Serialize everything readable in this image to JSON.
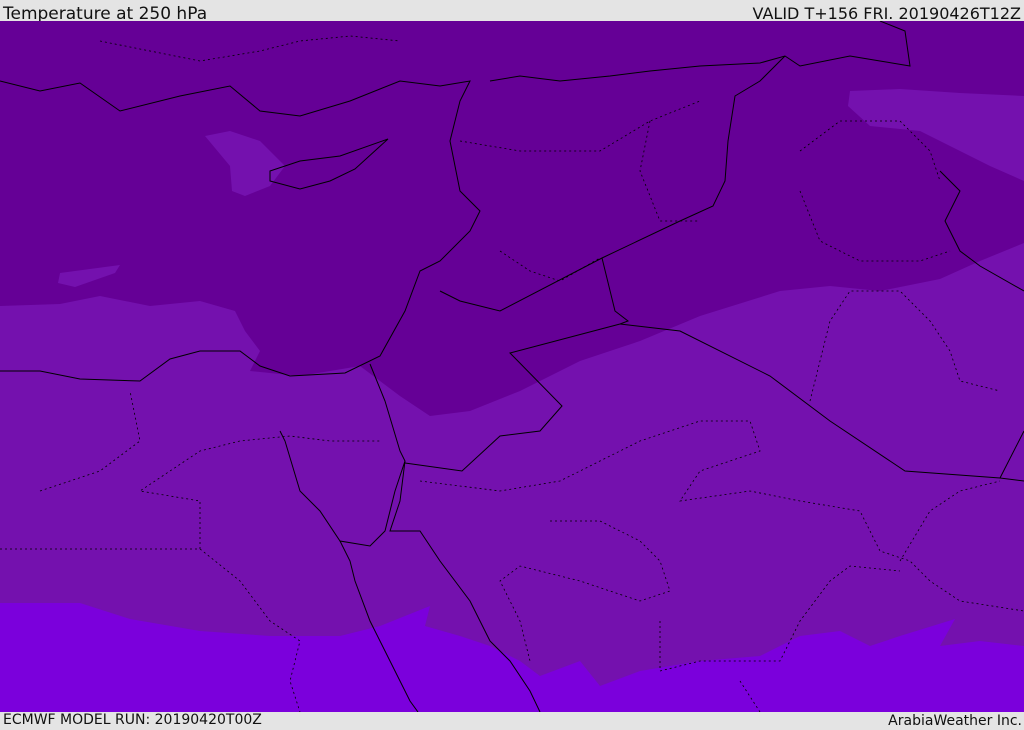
{
  "header": {
    "title": "Temperature at 250 hPa",
    "valid": "VALID T+156 FRI. 20190426T12Z"
  },
  "footer": {
    "model_run": "ECMWF MODEL RUN: 20190420T00Z",
    "credit": "ArabiaWeather Inc."
  },
  "colors": {
    "band_cold": "#650096",
    "band_mid": "#7411ae",
    "band_warm": "#7b00dc",
    "borders": "#000000"
  }
}
